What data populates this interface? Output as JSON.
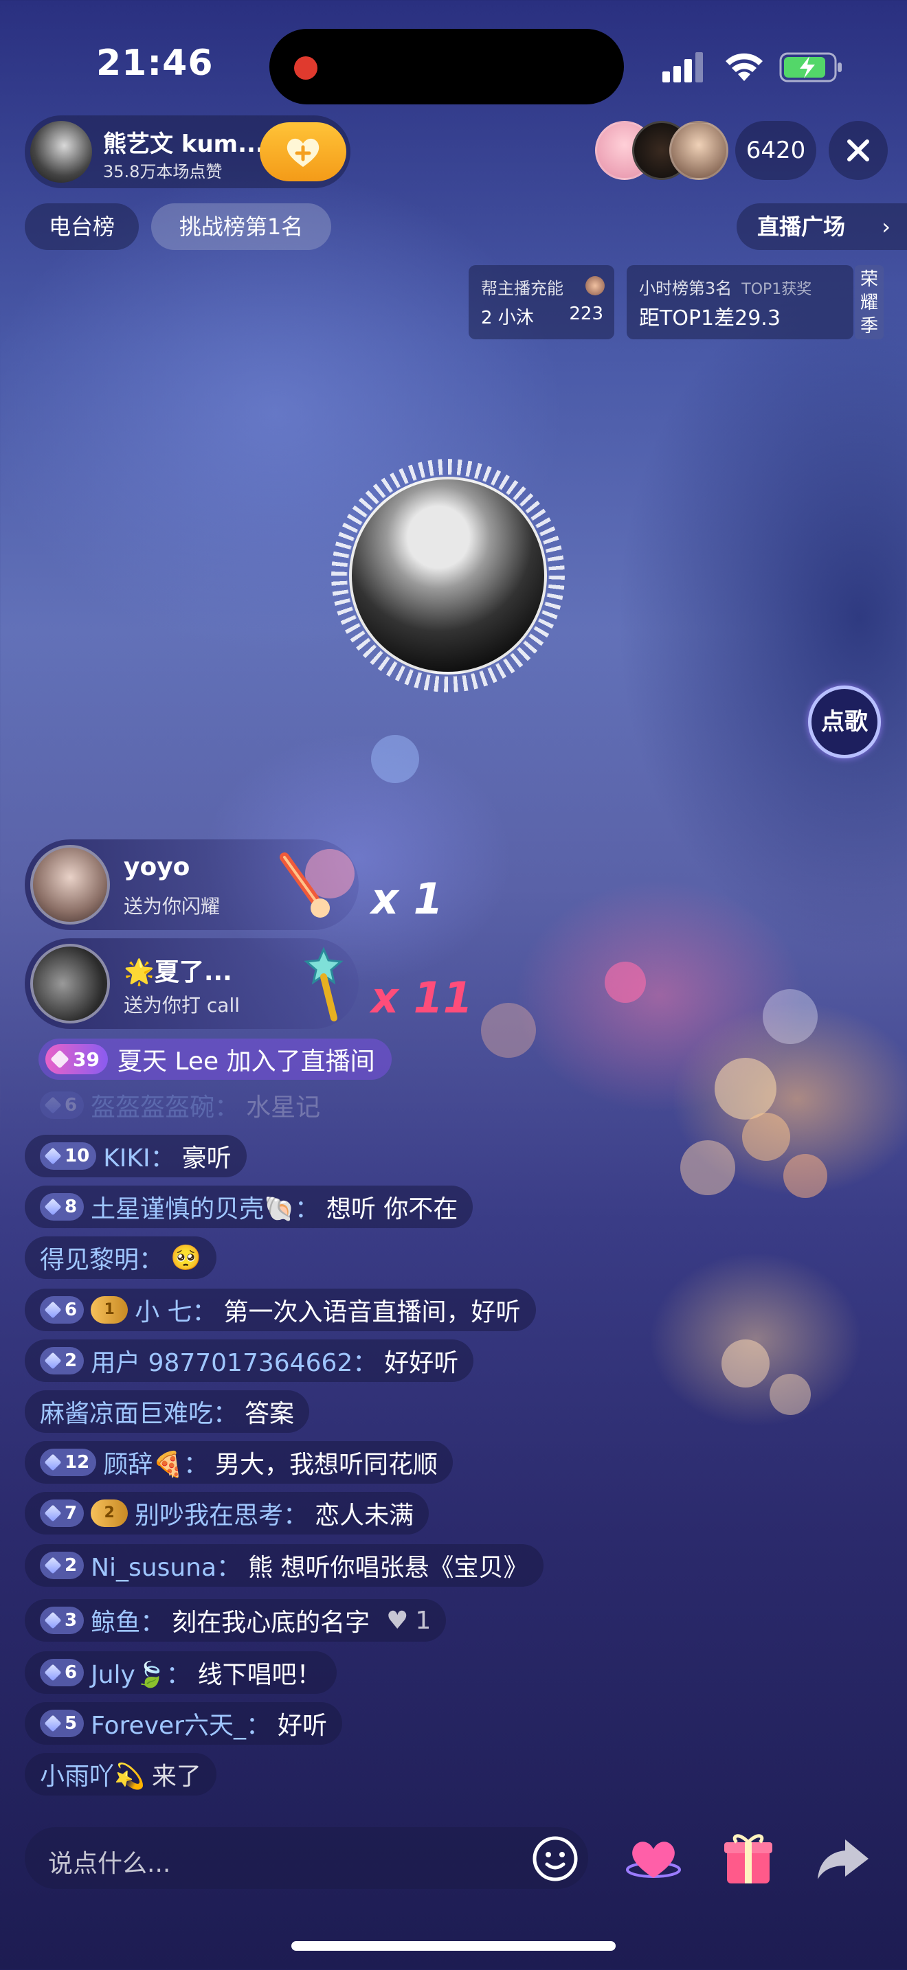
{
  "status_bar": {
    "time": "21:46"
  },
  "host": {
    "name": "熊艺文 kum...",
    "likes": "35.8万本场点赞"
  },
  "viewers": {
    "count": "6420"
  },
  "chips": {
    "radio_rank": "电台榜",
    "challenge_rank": "挑战榜第1名",
    "plaza": "直播广场"
  },
  "rank_boxes": {
    "charge_title": "帮主播充能",
    "charge_user": "2 小沐",
    "charge_value": "223",
    "hour_rank": "小时榜第3名",
    "top1_prize": "TOP1获奖",
    "gap_to_top1": "距TOP1差29.3",
    "honor_season": "荣耀季"
  },
  "song_request": {
    "label": "点歌"
  },
  "gifts": [
    {
      "name": "yoyo",
      "sub": "送为你闪耀",
      "multiplier": "x 1",
      "color": "#ffffff"
    },
    {
      "name": "🌟夏了...",
      "sub": "送为你打 call",
      "multiplier": "x 11",
      "color": "#ff4d7a"
    }
  ],
  "join_message": {
    "level": "39",
    "text": "夏天 Lee 加入了直播间"
  },
  "chat": [
    {
      "level": "6",
      "name": "盔盔盔盔碗：",
      "text": "水星记",
      "faded": true
    },
    {
      "level": "10",
      "name": "KIKI：",
      "text": "豪听"
    },
    {
      "level": "8",
      "name": "土星谨慎的贝壳🐚：",
      "text": "想听 你不在"
    },
    {
      "level": "",
      "name": "得见黎明：",
      "text": "🥺"
    },
    {
      "level": "6",
      "fan": "1",
      "name": "小 七：",
      "text": "第一次入语音直播间，好听"
    },
    {
      "level": "2",
      "name": "用户 9877017364662：",
      "text": "好好听"
    },
    {
      "level": "",
      "name": "麻酱凉面巨难吃：",
      "text": "答案"
    },
    {
      "level": "12",
      "name": "顾辞🍕：",
      "text": "男大，我想听同花顺"
    },
    {
      "level": "7",
      "fan": "2",
      "name": "别吵我在思考：",
      "text": "恋人未满"
    },
    {
      "level": "2",
      "name": "Ni_susuna：",
      "text": "熊 想听你唱张悬《宝贝》"
    },
    {
      "level": "3",
      "name": "鲸鱼：",
      "text": "刻在我心底的名字",
      "likes": "1"
    },
    {
      "level": "6",
      "name": "July🍃：",
      "text": "线下唱吧！"
    },
    {
      "level": "5",
      "name": "Forever六天_：",
      "text": "好听"
    },
    {
      "level": "",
      "name": "小雨吖💫",
      "text": "来了"
    }
  ],
  "bottom_bar": {
    "input_placeholder": "说点什么..."
  },
  "icons": [
    "heart-icon",
    "smile-icon",
    "gift-icon",
    "share-icon",
    "close-icon",
    "chevron-right-icon",
    "wifi-icon",
    "battery-icon",
    "signal-icon"
  ]
}
